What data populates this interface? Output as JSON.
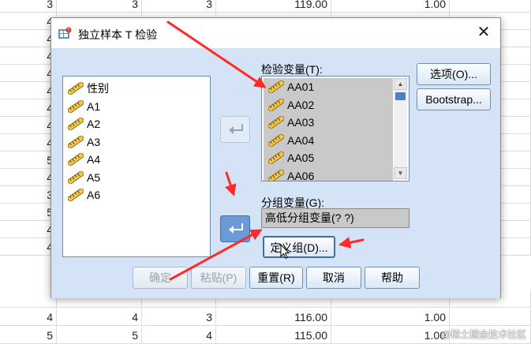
{
  "sheet": {
    "rows": [
      [
        "3",
        "3",
        "3",
        "119.00",
        "1.00"
      ],
      [
        "4",
        "",
        "",
        "",
        ""
      ],
      [
        "4",
        "",
        "",
        "",
        ""
      ],
      [
        "4",
        "",
        "",
        "",
        ""
      ],
      [
        "4",
        "",
        "",
        "",
        ""
      ],
      [
        "4",
        "",
        "",
        "",
        ""
      ],
      [
        "4",
        "",
        "",
        "",
        ""
      ],
      [
        "4",
        "",
        "",
        "",
        ""
      ],
      [
        "4",
        "",
        "",
        "",
        ""
      ],
      [
        "5",
        "",
        "",
        "",
        ""
      ],
      [
        "4",
        "",
        "",
        "",
        ""
      ],
      [
        "3",
        "",
        "",
        "",
        ""
      ],
      [
        "5",
        "",
        "",
        "",
        ""
      ],
      [
        "4",
        "",
        "",
        "",
        ""
      ],
      [
        "4",
        "",
        "",
        "",
        ""
      ],
      [
        "",
        "",
        "",
        "",
        ""
      ],
      [
        "4",
        "4",
        "3",
        "116.00",
        "1.00"
      ],
      [
        "5",
        "5",
        "4",
        "115.00",
        "1.00"
      ]
    ]
  },
  "dialog": {
    "title": "独立样本 T 检验",
    "close_glyph": "✕",
    "source_variables": [
      "性别",
      "A1",
      "A2",
      "A3",
      "A4",
      "A5",
      "A6"
    ],
    "test_variable_label": "检验变量(T):",
    "test_variables": [
      "AA01",
      "AA02",
      "AA03",
      "AA04",
      "AA05",
      "AA06"
    ],
    "grouping_label": "分组变量(G):",
    "grouping_value": "高低分组变量(? ?)",
    "buttons": {
      "options": "选项(O)...",
      "bootstrap": "Bootstrap...",
      "define_groups": "定义组(D)...",
      "ok": "确定",
      "paste": "粘贴(P)",
      "reset": "重置(R)",
      "cancel": "取消",
      "help": "帮助"
    }
  },
  "colors": {
    "dialog_body": "#d4e3f5",
    "annotation_arrow": "#ff2a2a",
    "selected_item": "#c9c9c9"
  },
  "watermark": "@稀土掘金技术社区"
}
